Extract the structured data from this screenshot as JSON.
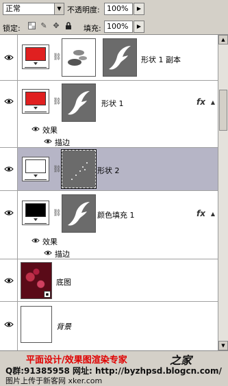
{
  "toolbar": {
    "blend_mode": "正常",
    "opacity_label": "不透明度:",
    "opacity_value": "100%",
    "lock_label": "锁定:",
    "fill_label": "填充:",
    "fill_value": "100%"
  },
  "layers": [
    {
      "name": "形状 1 副本",
      "thumb_color": "#e02020",
      "has_fx": false,
      "selected": false
    },
    {
      "name": "形状 1",
      "thumb_color": "#e02020",
      "has_fx": true,
      "selected": false,
      "effects_label": "效果",
      "effect_items": [
        "描边"
      ]
    },
    {
      "name": "形状 2",
      "thumb_color": "#ffffff",
      "has_fx": false,
      "selected": true
    },
    {
      "name": "颜色填充 1",
      "thumb_color": "#000000",
      "has_fx": true,
      "selected": false,
      "effects_label": "效果",
      "effect_items": [
        "描边"
      ]
    },
    {
      "name": "底图",
      "thumb_color": "#7a1020",
      "has_fx": false,
      "selected": false
    },
    {
      "name": "背景",
      "thumb_color": "#ffffff",
      "has_fx": false,
      "selected": false
    }
  ],
  "fx_symbol": "fx",
  "watermark": {
    "line1": "平面设计/效果图渲染专家",
    "line2": "Q群:91385958   网址: http://byzhpsd.blogcn.com/",
    "line3": "图片上传于新客网 xker.com",
    "logo": "之家"
  }
}
